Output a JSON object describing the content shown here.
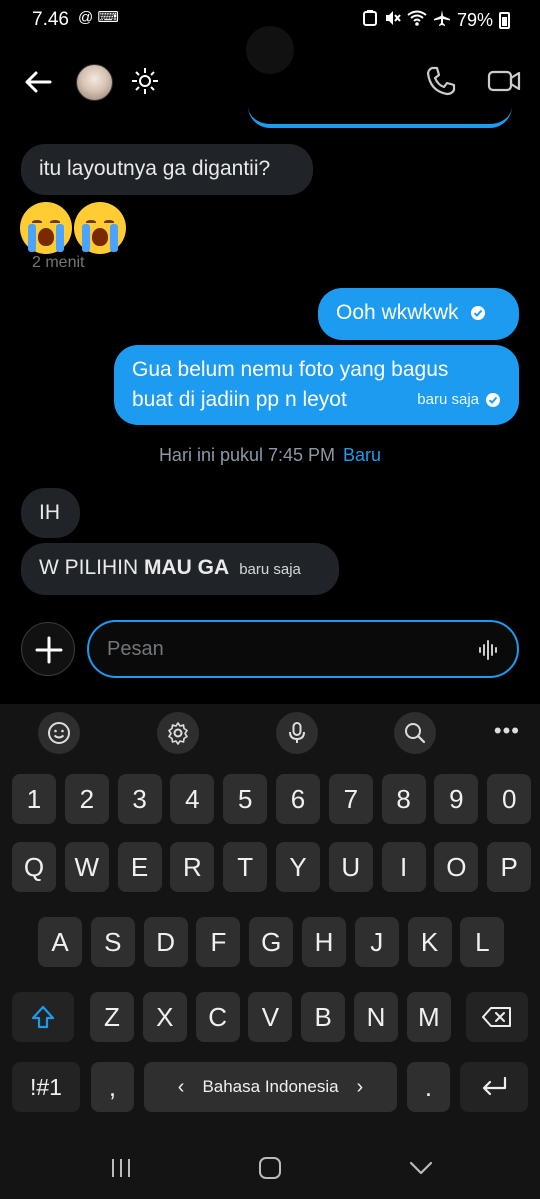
{
  "status_bar": {
    "time": "7.46",
    "left_icons": "@ ⌨",
    "battery": "79%"
  },
  "header": {
    "back_label": "Back",
    "call_label": "Call",
    "video_label": "Video"
  },
  "messages": [
    {
      "direction": "incoming",
      "text": "itu layoutnya ga digantii?"
    },
    {
      "direction": "incoming",
      "emoji": [
        "😭",
        "😭"
      ],
      "time": "2 menit"
    },
    {
      "direction": "outgoing",
      "text": "Ooh wkwkwk"
    },
    {
      "direction": "outgoing",
      "line1": "Gua belum nemu foto yang bagus",
      "line2": "buat di jadiin pp n leyot",
      "time": "baru saja"
    },
    {
      "direction": "incoming",
      "text": "IH"
    },
    {
      "direction": "incoming",
      "text_normal": "W PILIHIN ",
      "text_bold": "MAU GA",
      "time": "baru saja"
    }
  ],
  "divider": {
    "text": "Hari ini pukul 7:45 PM",
    "badge": "Baru"
  },
  "composer": {
    "placeholder": "Pesan",
    "value": ""
  },
  "keyboard": {
    "number_row": [
      "1",
      "2",
      "3",
      "4",
      "5",
      "6",
      "7",
      "8",
      "9",
      "0"
    ],
    "row1": [
      "Q",
      "W",
      "E",
      "R",
      "T",
      "Y",
      "U",
      "I",
      "O",
      "P"
    ],
    "row2": [
      "A",
      "S",
      "D",
      "F",
      "G",
      "H",
      "J",
      "K",
      "L"
    ],
    "row3": [
      "Z",
      "X",
      "C",
      "V",
      "B",
      "N",
      "M"
    ],
    "symbols_label": "!#1",
    "comma": ",",
    "space_label": "Bahasa Indonesia",
    "period": "."
  },
  "colors": {
    "accent": "#1d9bf0",
    "incoming_bubble": "#202327",
    "background": "#000000"
  }
}
